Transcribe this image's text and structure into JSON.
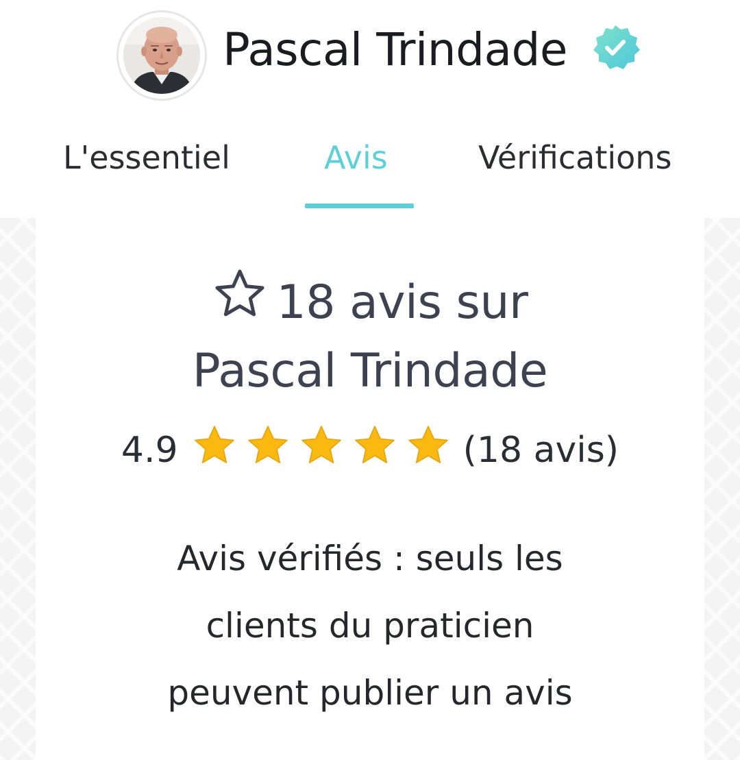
{
  "profile": {
    "name": "Pascal Trindade",
    "verified": true,
    "badge_color": "#5ccfd9"
  },
  "tabs": [
    {
      "label": "L'essentiel",
      "active": false
    },
    {
      "label": "Avis",
      "active": true
    },
    {
      "label": "Vérifications",
      "active": false
    }
  ],
  "colors": {
    "accent": "#5ccfd9",
    "star": "#f9b911",
    "text": "#2a2d33",
    "heading": "#3e4250"
  },
  "reviews": {
    "title_line1": "18 avis sur",
    "title_line2": "Pascal Trindade",
    "rating": "4.9",
    "stars_filled": 5,
    "stars_total": 5,
    "count_label": "(18 avis)",
    "notice_line1": "Avis vérifiés : seuls les",
    "notice_line2": "clients du praticien",
    "notice_line3": "peuvent publier un avis"
  },
  "icons": {
    "title_icon": "star-outline-icon",
    "rating_icon": "star-filled-icon",
    "badge_icon": "verified-badge-icon"
  }
}
